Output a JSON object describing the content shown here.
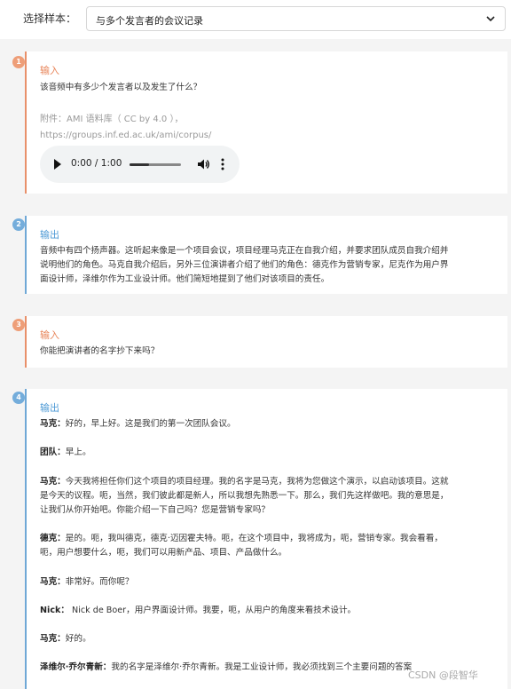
{
  "header": {
    "select_label": "选择样本：",
    "select_value": "与多个发言者的会议记录"
  },
  "cards": [
    {
      "badge": "1",
      "title": "输入",
      "text": "该音频中有多少个发言者以及发生了什么？",
      "attachment_line1": "附件：AMI 语料库（ CC by 4.0 ），",
      "attachment_line2": "https://groups.inf.ed.ac.uk/ami/corpus/",
      "audio": {
        "time": "0:00 / 1:00",
        "progress": 0.38
      }
    },
    {
      "badge": "2",
      "title": "输出",
      "lines": [
        "音频中有四个扬声器。这听起来像是一个项目会议，项目经理马克正在自我介绍，并要求团队成员自我介绍并",
        "说明他们的角色。马克自我介绍后，另外三位演讲者介绍了他们的角色：德克作为营销专家，尼克作为用户界",
        "面设计师，泽维尔作为工业设计师。他们简短地提到了他们对该项目的责任。"
      ]
    },
    {
      "badge": "3",
      "title": "输入",
      "text": "你能把演讲者的名字抄下来吗？"
    },
    {
      "badge": "4",
      "title": "输出",
      "dialogue": [
        {
          "speaker": "马克：",
          "lines": [
            "好的，早上好。这是我们的第一次团队会议。"
          ]
        },
        {
          "speaker": "团队：",
          "lines": [
            "早上。"
          ]
        },
        {
          "speaker": "马克：",
          "lines": [
            "今天我将担任你们这个项目的项目经理。我的名字是马克，我将为您做这个演示，以启动该项目。这就",
            "是今天的议程。呃，当然，我们彼此都是新人，所以我想先熟悉一下。那么，我们先这样做吧。我的意思是，",
            "让我们从你开始吧。你能介绍一下自己吗？您是营销专家吗？"
          ]
        },
        {
          "speaker": "德克：",
          "lines": [
            "是的。呃，我叫德克，德克·迈因霍夫特。呃，在这个项目中，我将成为，呃，营销专家。我会看看，",
            "呃，用户想要什么，呃，我们可以用新产品、项目、产品做什么。"
          ]
        },
        {
          "speaker": "马克：",
          "lines": [
            "非常好。而你呢？"
          ]
        },
        {
          "speaker": "Nick：",
          "lines": [
            " Nick de Boer，用户界面设计师。我要，呃，从用户的角度来看技术设计。"
          ]
        },
        {
          "speaker": "马克：",
          "lines": [
            "好的。"
          ]
        },
        {
          "speaker": "泽维尔·乔尔青新：",
          "lines": [
            "我的名字是泽维尔·乔尔青新。我是工业设计师，我必须找到三个主要问题的答案"
          ]
        }
      ]
    }
  ],
  "watermark": "CSDN @段智华"
}
